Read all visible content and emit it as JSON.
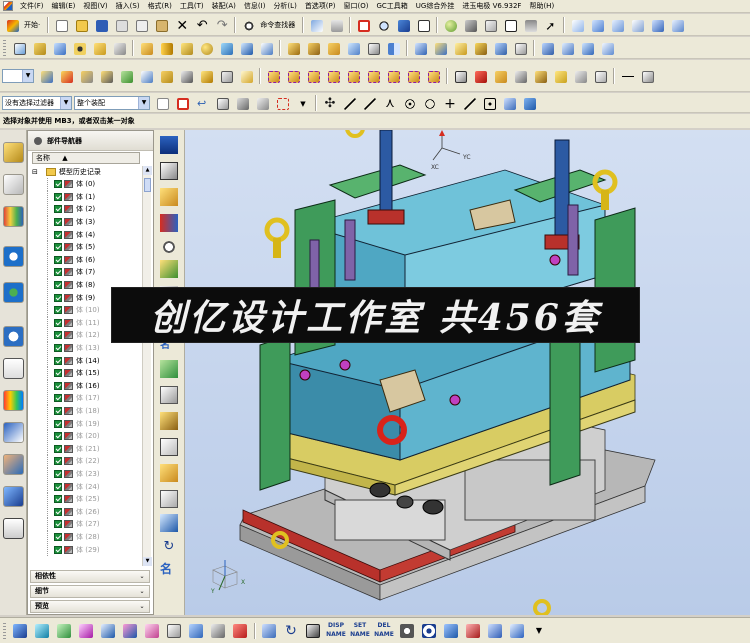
{
  "menubar": {
    "items": [
      "文件(F)",
      "编辑(E)",
      "视图(V)",
      "插入(S)",
      "格式(R)",
      "工具(T)",
      "装配(A)",
      "信息(I)",
      "分析(L)",
      "首选项(P)",
      "窗口(O)",
      "GC工具箱",
      "UG综合外挂",
      "进玉电极 V6.932F",
      "帮助(H)"
    ]
  },
  "toolbar1": {
    "start_label": "开始·",
    "command_finder_label": "命令查找器"
  },
  "selection_bar": {
    "filter_value": "没有选择过滤器",
    "scope_value": "整个装配"
  },
  "status": {
    "prompt": "选择对象并使用 MB3，或者双击某一对象"
  },
  "navigator": {
    "title": "部件导航器",
    "column_header": "名称",
    "root_label": "模型历史记录",
    "items": [
      {
        "label": "体 (0)",
        "dim": false
      },
      {
        "label": "体 (1)",
        "dim": false
      },
      {
        "label": "体 (2)",
        "dim": false
      },
      {
        "label": "体 (3)",
        "dim": false
      },
      {
        "label": "体 (4)",
        "dim": false
      },
      {
        "label": "体 (5)",
        "dim": false
      },
      {
        "label": "体 (6)",
        "dim": false
      },
      {
        "label": "体 (7)",
        "dim": false
      },
      {
        "label": "体 (8)",
        "dim": false
      },
      {
        "label": "体 (9)",
        "dim": false
      },
      {
        "label": "体 (10)",
        "dim": true
      },
      {
        "label": "体 (11)",
        "dim": true
      },
      {
        "label": "体 (12)",
        "dim": true
      },
      {
        "label": "体 (13)",
        "dim": true
      },
      {
        "label": "体 (14)",
        "dim": false
      },
      {
        "label": "体 (15)",
        "dim": false
      },
      {
        "label": "体 (16)",
        "dim": false
      },
      {
        "label": "体 (17)",
        "dim": true
      },
      {
        "label": "体 (18)",
        "dim": true
      },
      {
        "label": "体 (19)",
        "dim": true
      },
      {
        "label": "体 (20)",
        "dim": true
      },
      {
        "label": "体 (21)",
        "dim": true
      },
      {
        "label": "体 (22)",
        "dim": true
      },
      {
        "label": "体 (23)",
        "dim": true
      },
      {
        "label": "体 (24)",
        "dim": true
      },
      {
        "label": "体 (25)",
        "dim": true
      },
      {
        "label": "体 (26)",
        "dim": true
      },
      {
        "label": "体 (27)",
        "dim": true
      },
      {
        "label": "体 (28)",
        "dim": true
      },
      {
        "label": "体 (29)",
        "dim": true
      }
    ],
    "sections": [
      "相依性",
      "细节",
      "预览"
    ]
  },
  "viewport": {
    "banner_text": "创亿设计工作室 共456套",
    "axis_top": {
      "x": "XC",
      "y": "YC"
    },
    "axis_bottom": {
      "y": "Y",
      "x": "X"
    }
  },
  "bottombar": {
    "disp_label": "DISP NAME",
    "set_label": "SET NAME",
    "del_label": "DEL NAME"
  },
  "colors": {
    "plate_green": "#3f9b5a",
    "plate_blue": "#4fa7c3",
    "plate_yellow": "#d8cc63",
    "plate_gray": "#bdbdbd",
    "plate_red": "#b8312b",
    "banner_bg": "#0c0c0c"
  }
}
